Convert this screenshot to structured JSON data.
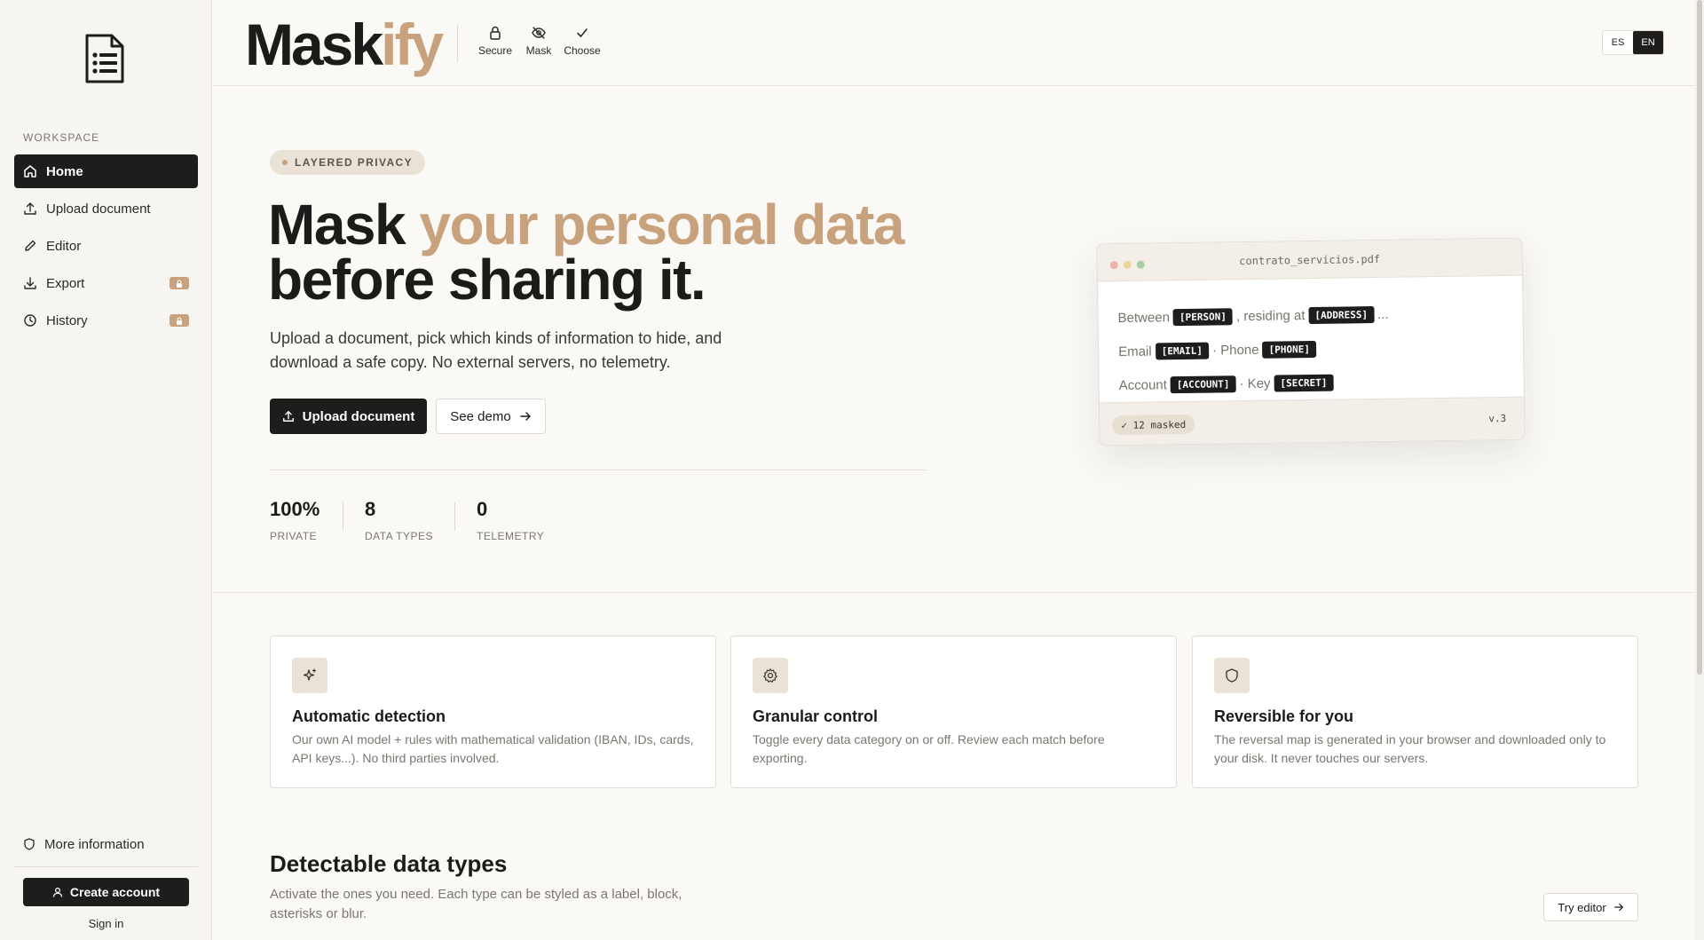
{
  "sidebar": {
    "section_label": "WORKSPACE",
    "items": [
      {
        "label": "Home",
        "icon": "home-icon",
        "active": true,
        "locked": false
      },
      {
        "label": "Upload document",
        "icon": "upload-icon",
        "active": false,
        "locked": false
      },
      {
        "label": "Editor",
        "icon": "pencil-icon",
        "active": false,
        "locked": false
      },
      {
        "label": "Export",
        "icon": "download-icon",
        "active": false,
        "locked": true
      },
      {
        "label": "History",
        "icon": "clock-icon",
        "active": false,
        "locked": true
      }
    ],
    "more_info": "More information",
    "create_account": "Create account",
    "sign_in": "Sign in"
  },
  "header": {
    "brand_main": "Mask",
    "brand_accent": "ify",
    "features": [
      {
        "label": "Secure",
        "icon": "lock-icon"
      },
      {
        "label": "Mask",
        "icon": "eye-off-icon"
      },
      {
        "label": "Choose",
        "icon": "check-icon"
      }
    ],
    "languages": [
      "ES",
      "EN"
    ],
    "active_language": "EN"
  },
  "hero": {
    "pill": "LAYERED PRIVACY",
    "title_plain_1": "Mask ",
    "title_accent": "your personal data",
    "title_line_2": "before sharing it.",
    "subtitle": "Upload a document, pick which kinds of information to hide, and download a safe copy. No external servers, no telemetry.",
    "primary_button": "Upload document",
    "secondary_button": "See demo",
    "stats": [
      {
        "value": "100%",
        "label": "PRIVATE"
      },
      {
        "value": "8",
        "label": "DATA TYPES"
      },
      {
        "value": "0",
        "label": "TELEMETRY"
      }
    ]
  },
  "preview": {
    "filename": "contrato_servicios.pdf",
    "line1": {
      "a": "Between",
      "tag1": "[PERSON]",
      "b": ", residing at",
      "tag2": "[ADDRESS]",
      "c": "..."
    },
    "line2": {
      "a": "Email",
      "tag1": "[EMAIL]",
      "b": "· Phone",
      "tag2": "[PHONE]"
    },
    "line3": {
      "a": "Account",
      "tag1": "[ACCOUNT]",
      "b": "· Key",
      "tag2": "[SECRET]"
    },
    "masked_badge": "✓ 12 masked",
    "version": "v.3"
  },
  "features": [
    {
      "title": "Automatic detection",
      "text": "Our own AI model + rules with mathematical validation (IBAN, IDs, cards, API keys...). No third parties involved.",
      "icon": "sparkle-icon"
    },
    {
      "title": "Granular control",
      "text": "Toggle every data category on or off. Review each match before exporting.",
      "icon": "gear-icon"
    },
    {
      "title": "Reversible for you",
      "text": "The reversal map is generated in your browser and downloaded only to your disk. It never touches our servers.",
      "icon": "shield-icon"
    }
  ],
  "types": {
    "title": "Detectable data types",
    "subtitle": "Activate the ones you need. Each type can be styled as a label, block, asterisks or blur.",
    "try_button": "Try editor"
  },
  "colors": {
    "accent": "#c7a27c",
    "dark": "#1e1d1b",
    "background": "#faf9f6"
  }
}
